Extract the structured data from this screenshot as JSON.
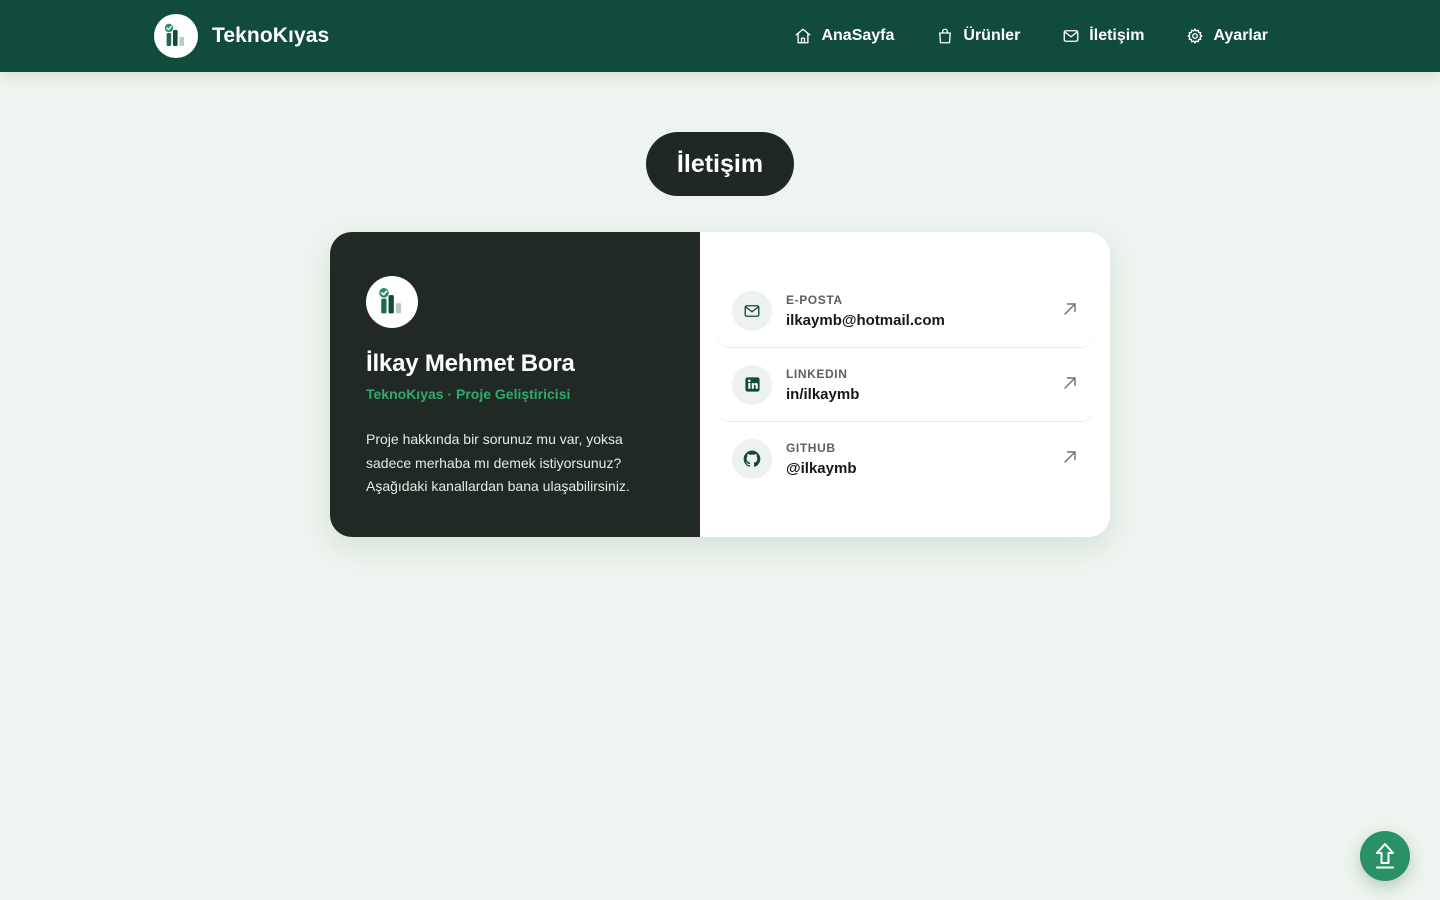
{
  "header": {
    "brand_name": "TeknoKıyas",
    "nav": [
      {
        "label": "AnaSayfa",
        "icon": "home-icon"
      },
      {
        "label": "Ürünler",
        "icon": "shopping-bag-icon"
      },
      {
        "label": "İletişim",
        "icon": "mail-icon"
      },
      {
        "label": "Ayarlar",
        "icon": "gear-icon"
      }
    ]
  },
  "page": {
    "title": "İletişim"
  },
  "profile": {
    "name": "İlkay Mehmet Bora",
    "role": "TeknoKıyas · Proje Geliştiricisi",
    "description": "Proje hakkında bir sorunuz mu var, yoksa sadece merhaba mı demek istiyorsunuz? Aşağıdaki kanallardan bana ulaşabilirsiniz."
  },
  "contacts": [
    {
      "label": "E-POSTA",
      "value": "ilkaymb@hotmail.com",
      "icon": "mail-icon"
    },
    {
      "label": "LINKEDIN",
      "value": "in/ilkaymb",
      "icon": "linkedin-icon"
    },
    {
      "label": "GITHUB",
      "value": "@ilkaymb",
      "icon": "github-icon"
    }
  ],
  "colors": {
    "header_bg": "#114b3c",
    "page_bg": "#eef4ef",
    "dark_panel": "#212924",
    "accent_green": "#2faa6f",
    "scroll_button": "#2a9065"
  }
}
